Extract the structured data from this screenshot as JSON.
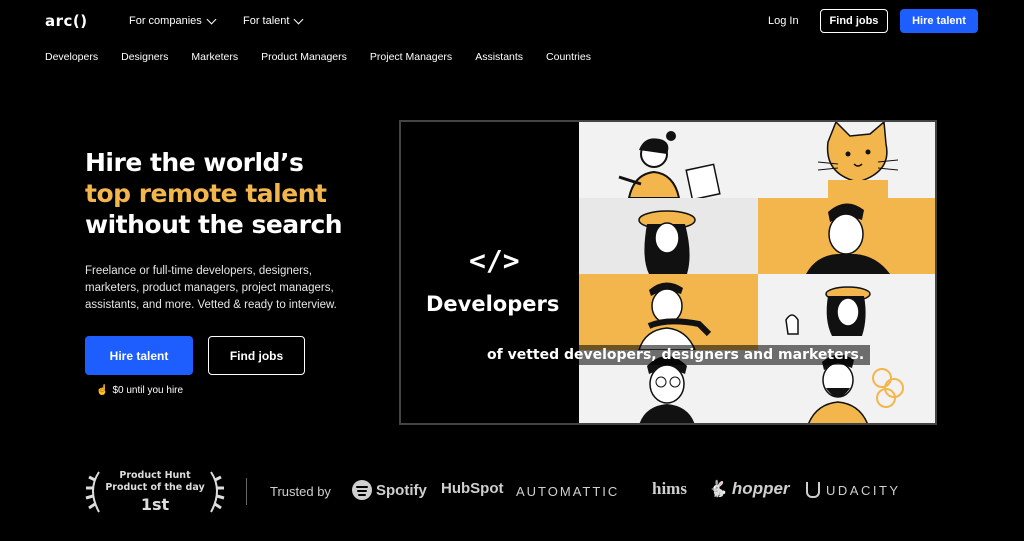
{
  "header": {
    "logo": "arc()",
    "nav": [
      {
        "label": "For companies"
      },
      {
        "label": "For talent"
      }
    ],
    "login": "Log In",
    "find_jobs": "Find jobs",
    "hire_talent": "Hire talent"
  },
  "categories": [
    "Developers",
    "Designers",
    "Marketers",
    "Product Managers",
    "Project Managers",
    "Assistants",
    "Countries"
  ],
  "hero": {
    "line1": "Hire the world’s",
    "line2": "top remote talent",
    "line3": "without the search",
    "description": "Freelance or full-time developers, designers, marketers, product managers, project managers, assistants, and more. Vetted & ready to interview.",
    "hire_button": "Hire talent",
    "find_button": "Find jobs",
    "note": "$0 until you hire"
  },
  "video": {
    "icon": "</>",
    "title": "Developers",
    "caption": "of vetted developers, designers and marketers."
  },
  "trust": {
    "award_line1": "Product Hunt",
    "award_line2": "Product of the day",
    "award_rank": "1st",
    "trusted_by": "Trusted by",
    "logos": [
      "Spotify",
      "HubSpot",
      "AUTOMATTIC",
      "hims",
      "hopper",
      "UDACITY"
    ]
  },
  "colors": {
    "accent": "#f2b64c",
    "primary": "#1e5eff",
    "background": "#000000"
  }
}
